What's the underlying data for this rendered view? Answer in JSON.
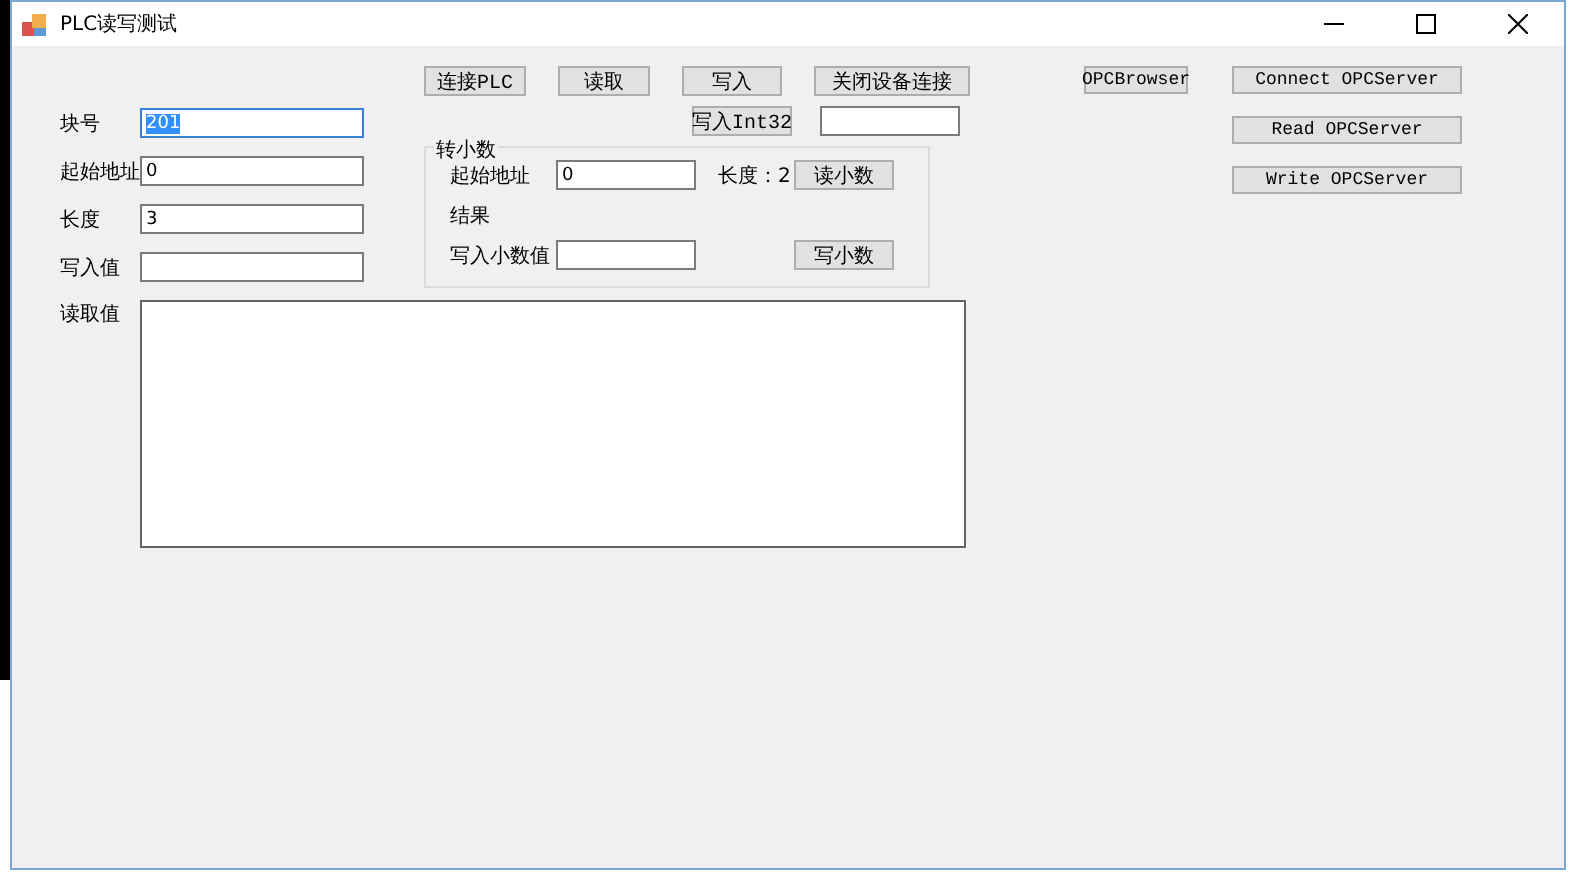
{
  "window": {
    "title": "PLC读写测试"
  },
  "fields": [
    {
      "label": "块号",
      "value": "201",
      "selected": true
    },
    {
      "label": "起始地址",
      "value": "0",
      "selected": false
    },
    {
      "label": "长度",
      "value": "3",
      "selected": false
    },
    {
      "label": "写入值",
      "selected": false
    }
  ],
  "plc_buttons": [
    "连接PLC",
    "读取",
    "写入",
    "关闭设备连接"
  ],
  "int32_button": "写入Int32",
  "decimal_group": {
    "title": "转小数",
    "start_label": "起始地址",
    "start_value": "0",
    "length_label": "长度：2",
    "read_button": "读小数",
    "result_label": "结果",
    "write_label": "写入小数值",
    "write_button": "写小数"
  },
  "opc_browser_button": "OPCBrowser",
  "opc_buttons": [
    "Connect OPCServer",
    "Read OPCServer",
    "Write OPCServer"
  ],
  "read_value": {
    "label": "读取值"
  }
}
